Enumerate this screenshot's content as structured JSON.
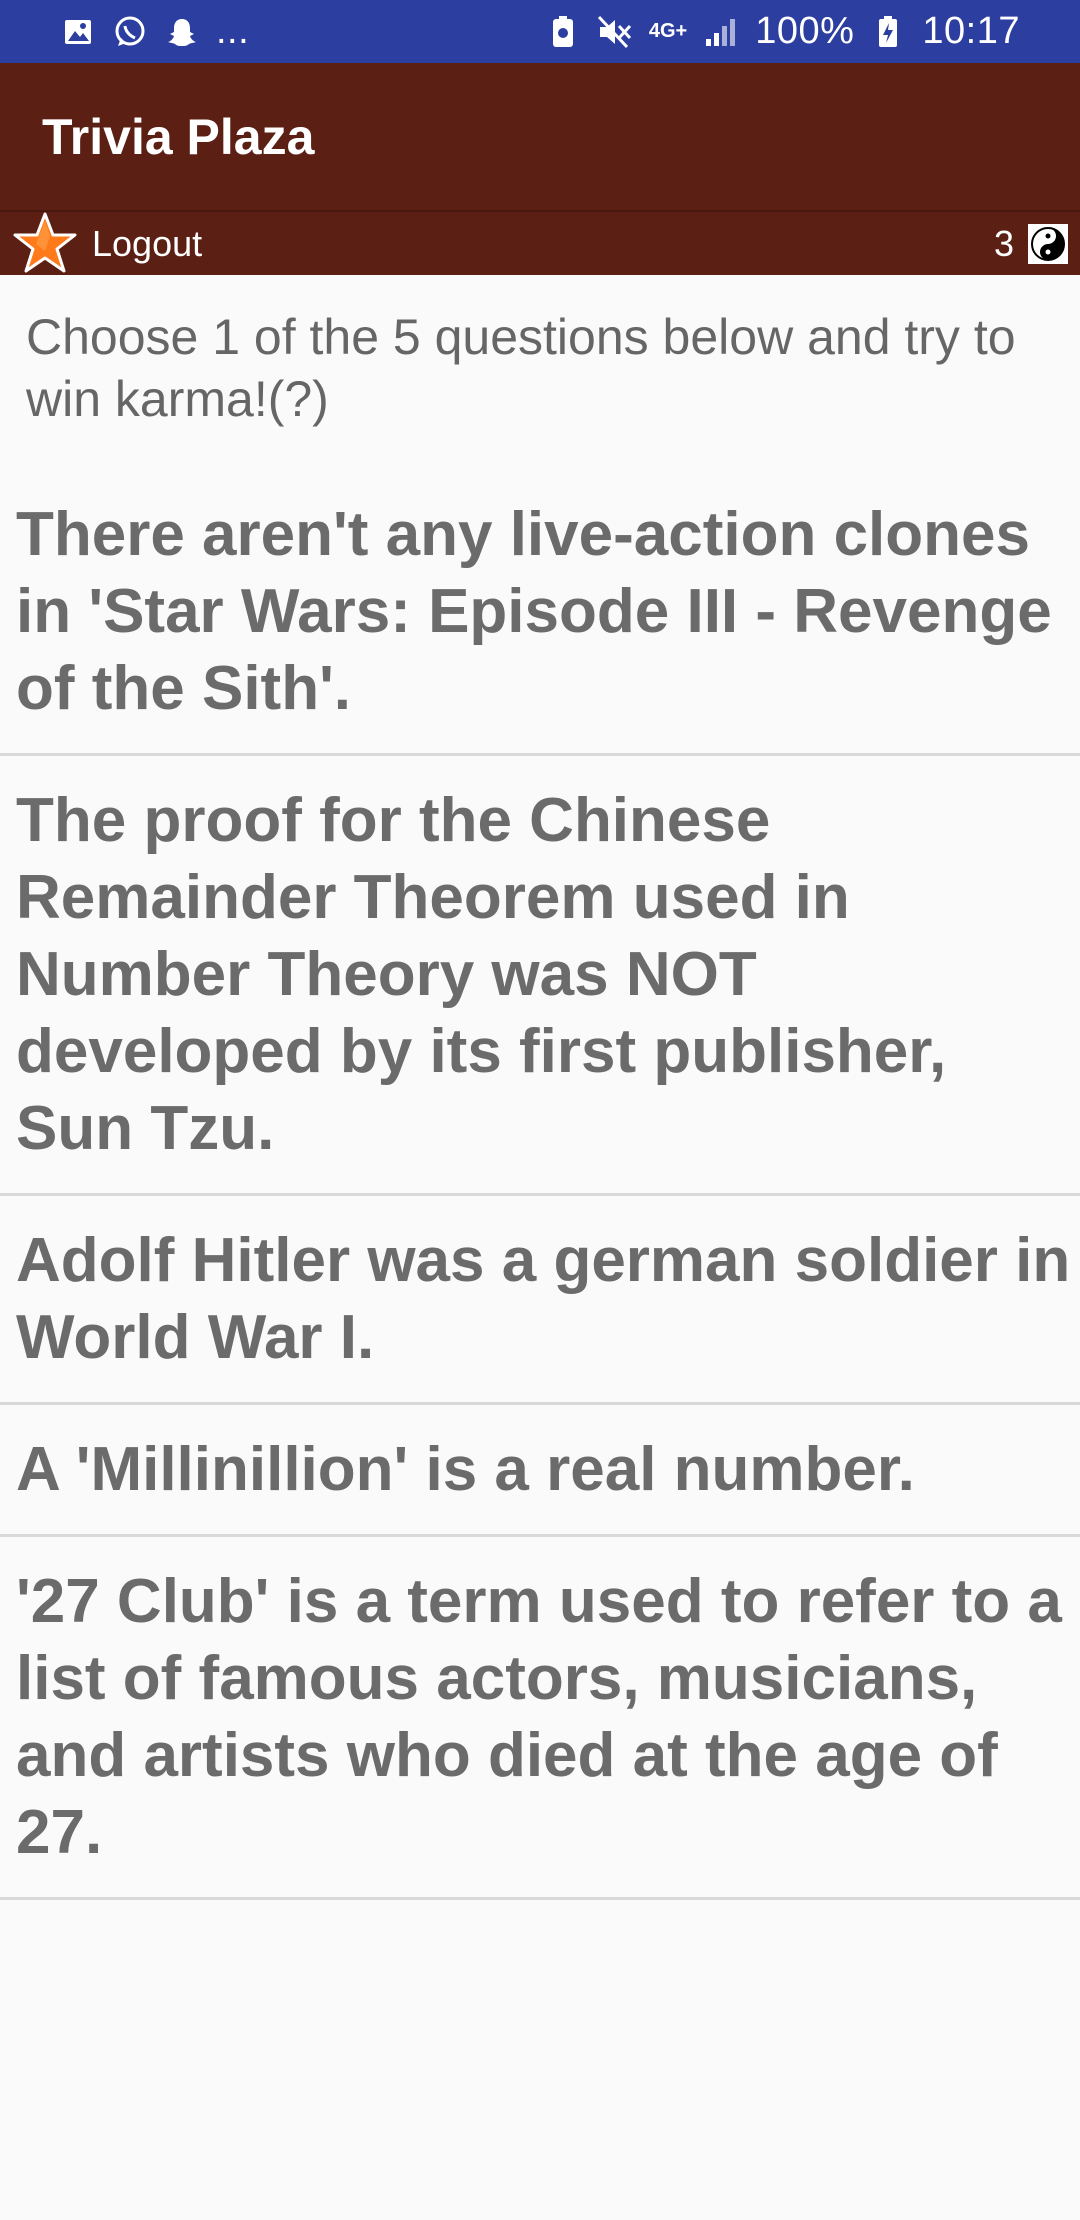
{
  "status_bar": {
    "icons_left": [
      "gallery-icon",
      "whatsapp-icon",
      "snapchat-icon"
    ],
    "more": "...",
    "network": "4G+",
    "battery": "100%",
    "time": "10:17"
  },
  "app": {
    "title": "Trivia Plaza"
  },
  "sub_bar": {
    "logout_label": "Logout",
    "karma_count": "3"
  },
  "intro": "Choose 1 of the 5 questions below and try to win karma!(?)",
  "questions": [
    "There aren't any live-action clones in 'Star Wars: Episode III - Revenge of the Sith'.",
    "The proof for the Chinese Remainder Theorem used in Number Theory was NOT developed by its first publisher, Sun Tzu.",
    "Adolf Hitler was a german soldier in World War I.",
    "A 'Millinillion' is a real number.",
    "'27 Club' is a term used to refer to a list of famous actors, musicians, and artists who died at the age of 27."
  ],
  "colors": {
    "status_bar": "#2c3e9f",
    "app_bar": "#5c1f14",
    "question_text": "#6b6b6b"
  }
}
